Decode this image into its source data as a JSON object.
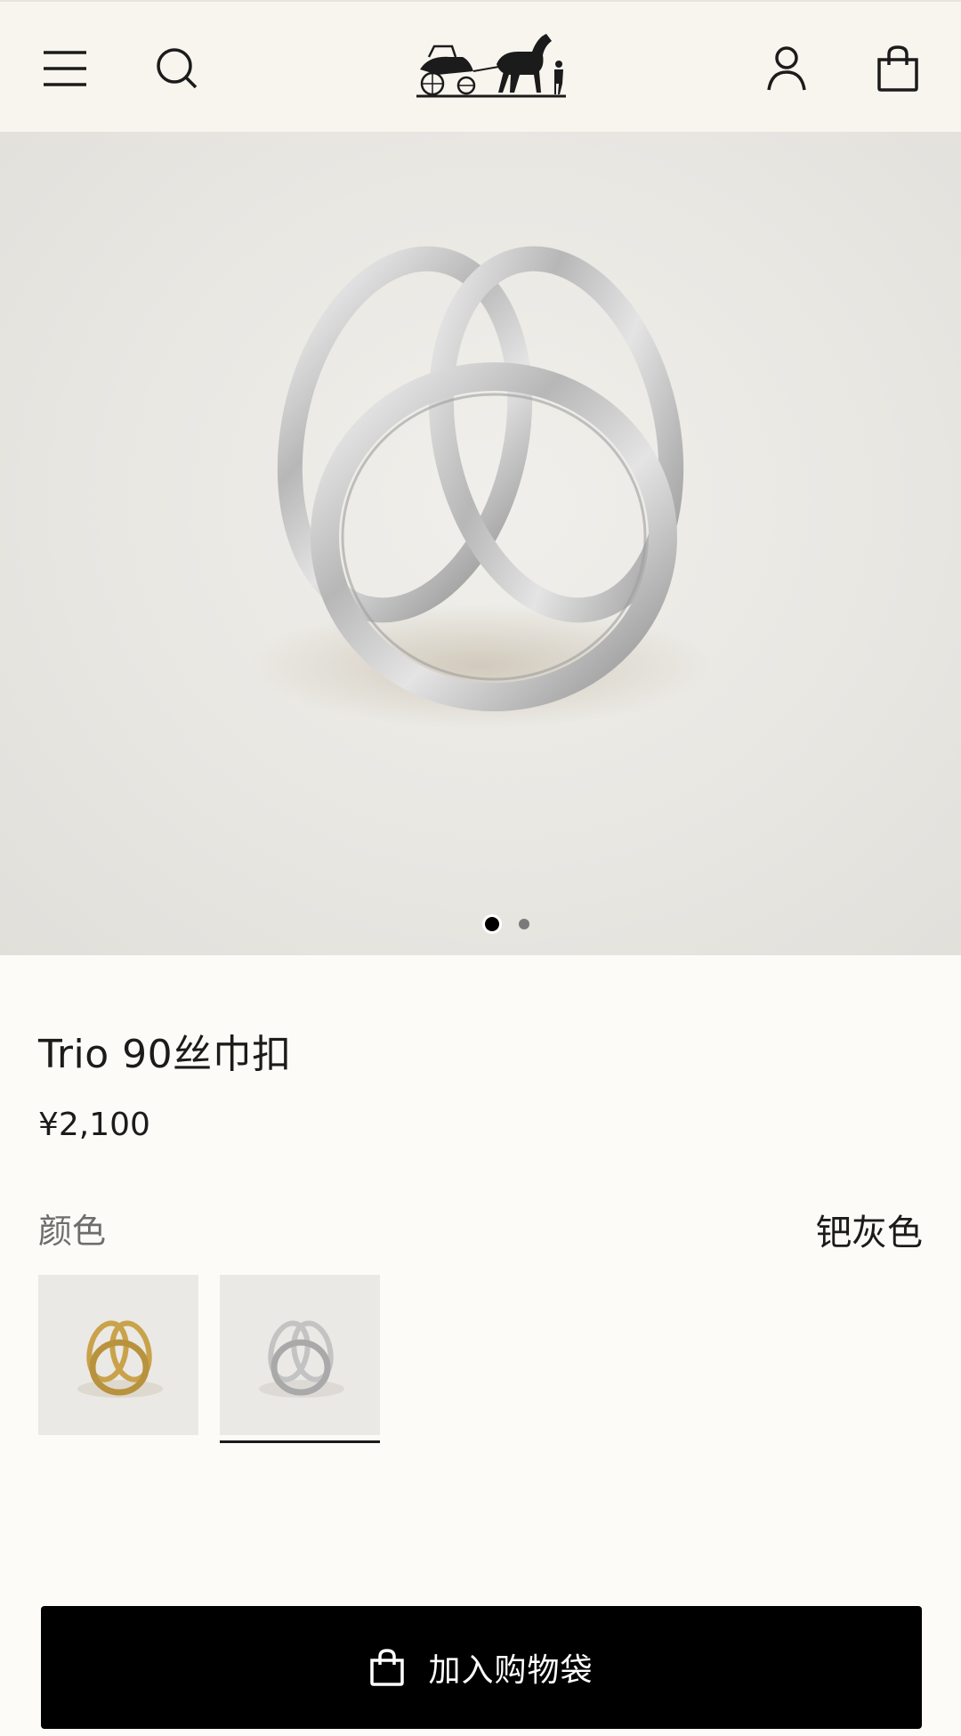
{
  "header": {
    "menu_icon": "hamburger-menu-icon",
    "search_icon": "search-icon",
    "logo_icon": "horse-carriage-logo-icon",
    "account_icon": "user-icon",
    "bag_icon": "shopping-bag-icon"
  },
  "gallery": {
    "slides": 2,
    "active_index": 0
  },
  "product": {
    "title": "Trio 90丝巾扣",
    "price": "¥2,100",
    "color_label": "颜色",
    "color_value": "钯灰色",
    "swatches": [
      {
        "name": "gold",
        "selected": false,
        "color": "#c9a24a"
      },
      {
        "name": "silver",
        "selected": true,
        "color": "#b9b9b9"
      }
    ]
  },
  "cta": {
    "label": "加入购物袋",
    "icon": "shopping-bag-icon"
  },
  "colors": {
    "header_bg": "#f8f5ef",
    "page_bg": "#fdfbf7",
    "cta_bg": "#000000",
    "cta_text": "#ffffff"
  }
}
